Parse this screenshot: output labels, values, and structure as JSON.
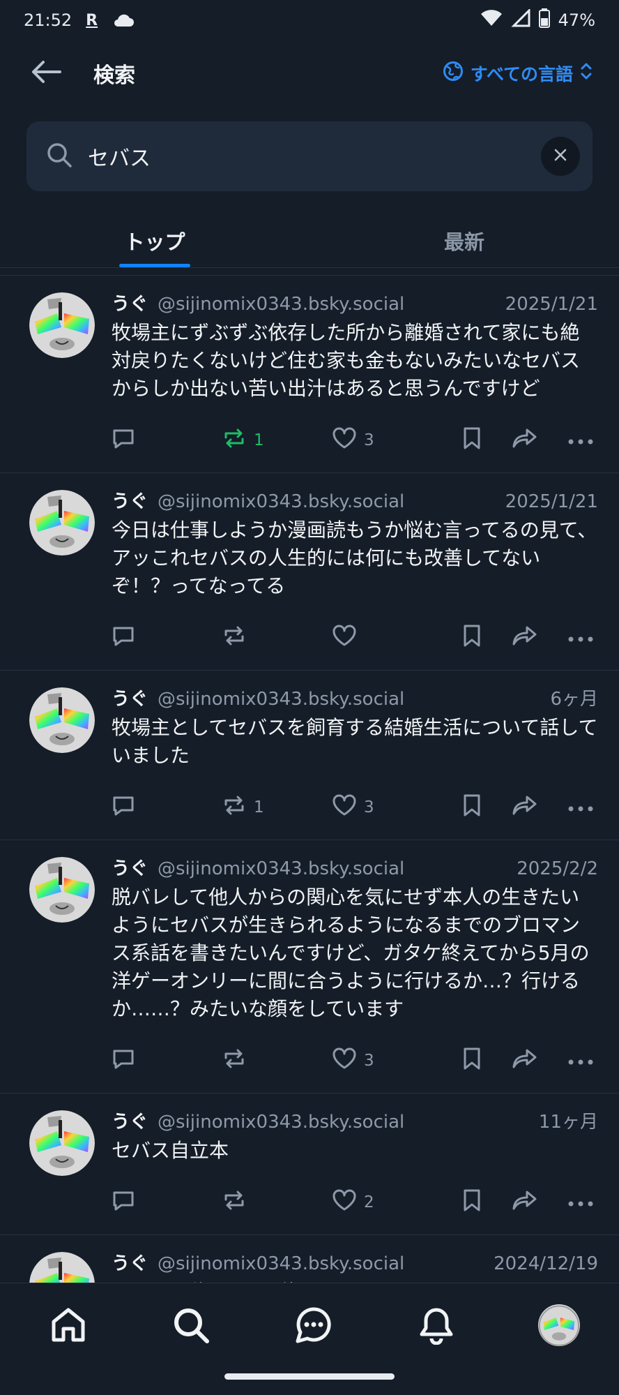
{
  "status": {
    "time": "21:52",
    "carrier_mark": "R",
    "battery": "47%"
  },
  "header": {
    "title": "検索",
    "language": "すべての言語"
  },
  "search": {
    "value": "セバス"
  },
  "tabs": [
    {
      "label": "トップ"
    },
    {
      "label": "最新"
    }
  ],
  "posts": [
    {
      "author": "うぐ",
      "handle": "@sijinomix0343.bsky.social",
      "date": "2025/1/21",
      "text": "牧場主にずぶずぶ依存した所から離婚されて家にも絶対戻りたくないけど住む家も金もないみたいなセバスからしか出ない苦い出汁はあると思うんですけど",
      "reposts": "1",
      "likes": "3"
    },
    {
      "author": "うぐ",
      "handle": "@sijinomix0343.bsky.social",
      "date": "2025/1/21",
      "text": "今日は仕事しようか漫画読もうか悩む言ってるの見て、アッこれセバスの人生的には何にも改善してないぞ！？ってなってる",
      "reposts": "",
      "likes": ""
    },
    {
      "author": "うぐ",
      "handle": "@sijinomix0343.bsky.social",
      "date": "6ヶ月",
      "text": "牧場主としてセバスを飼育する結婚生活について話していました",
      "reposts": "1",
      "likes": "3"
    },
    {
      "author": "うぐ",
      "handle": "@sijinomix0343.bsky.social",
      "date": "2025/2/2",
      "text": "脱バレして他人からの関心を気にせず本人の生きたいようにセバスが生きられるようになるまでのブロマンス系話を書きたいんですけど、ガタケ終えてから5月の洋ゲーオンリーに間に合うように行けるか…？行けるか……？みたいな顔をしています",
      "reposts": "",
      "likes": "3"
    },
    {
      "author": "うぐ",
      "handle": "@sijinomix0343.bsky.social",
      "date": "11ヶ月",
      "text": "セバス自立本",
      "reposts": "",
      "likes": "2"
    },
    {
      "author": "うぐ",
      "handle": "@sijinomix0343.bsky.social",
      "date": "2024/12/19",
      "text": "セバスは俺のことが好き",
      "reposts": "",
      "likes": ""
    }
  ],
  "colors": {
    "background": "#151d28",
    "accent": "#1083fe",
    "repost_active": "#20bc66",
    "muted": "#8e99a9"
  }
}
